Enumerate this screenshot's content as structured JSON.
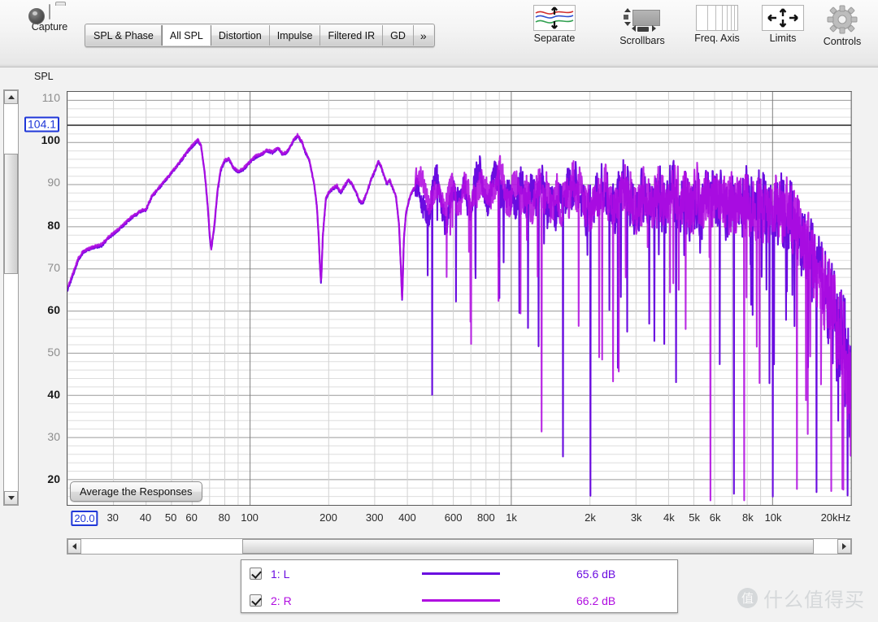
{
  "toolbar": {
    "capture": {
      "label": "Capture",
      "icon": "camera-icon"
    },
    "tabs": [
      {
        "label": "SPL & Phase",
        "active": false
      },
      {
        "label": "All SPL",
        "active": true
      },
      {
        "label": "Distortion",
        "active": false
      },
      {
        "label": "Impulse",
        "active": false
      },
      {
        "label": "Filtered IR",
        "active": false
      },
      {
        "label": "GD",
        "active": false
      },
      {
        "label": "»",
        "active": false
      }
    ],
    "buttons": [
      {
        "label": "Separate",
        "icon": "separate-traces-icon"
      },
      {
        "label": "Scrollbars",
        "icon": "scrollbars-icon"
      },
      {
        "label": "Freq. Axis",
        "icon": "frequency-axis-icon"
      },
      {
        "label": "Limits",
        "icon": "limits-arrows-icon"
      },
      {
        "label": "Controls",
        "icon": "gear-icon"
      }
    ]
  },
  "graph": {
    "y_axis_title": "SPL",
    "y_cursor_value": "104.1",
    "x_cursor_value": "20.0",
    "average_button_label": "Average the Responses"
  },
  "legend": {
    "rows": [
      {
        "checked": true,
        "name": "1: L",
        "color": "#6a0ce0",
        "value": "65.6 dB"
      },
      {
        "checked": true,
        "name": "2: R",
        "color": "#b00ce0",
        "value": "66.2 dB"
      }
    ]
  },
  "watermark": {
    "logo": "值",
    "text": "什么值得买"
  },
  "chart_data": {
    "type": "line",
    "title": "All SPL",
    "xlabel": "",
    "ylabel": "SPL",
    "xscale": "log",
    "xlim": [
      20,
      20000
    ],
    "ylim": [
      14,
      112
    ],
    "grid": true,
    "legend_position": "bottom",
    "y_ticks_major": [
      100,
      80,
      60,
      40,
      20
    ],
    "y_ticks_minor": [
      110,
      90,
      70,
      50,
      30
    ],
    "y_tick_labels": [
      "110",
      "100",
      "90",
      "80",
      "70",
      "60",
      "50",
      "40",
      "30",
      "20"
    ],
    "x_tick_labels": [
      "20.0",
      "30",
      "40",
      "50",
      "60",
      "80",
      "100",
      "200",
      "300",
      "400",
      "600",
      "800",
      "1k",
      "2k",
      "3k",
      "4k",
      "5k",
      "6k",
      "8k",
      "10k",
      "20kHz"
    ],
    "x_tick_values": [
      20,
      30,
      40,
      50,
      60,
      80,
      100,
      200,
      300,
      400,
      600,
      800,
      1000,
      2000,
      3000,
      4000,
      5000,
      6000,
      8000,
      10000,
      20000
    ],
    "cursor_line_y": 104.1,
    "series": [
      {
        "name": "1: L",
        "color": "#6a0ce0",
        "value_label": "65.6 dB",
        "points": [
          [
            20,
            65.0
          ],
          [
            21,
            68.5
          ],
          [
            22,
            72.0
          ],
          [
            23,
            74.0
          ],
          [
            25,
            75.0
          ],
          [
            27,
            75.5
          ],
          [
            29,
            77.5
          ],
          [
            31,
            79.0
          ],
          [
            33,
            80.5
          ],
          [
            35,
            82.0
          ],
          [
            37,
            83.0
          ],
          [
            38,
            83.5
          ],
          [
            40,
            84.0
          ],
          [
            42,
            87.0
          ],
          [
            44,
            88.5
          ],
          [
            46,
            90.0
          ],
          [
            49,
            92.0
          ],
          [
            52,
            94.0
          ],
          [
            55,
            96.0
          ],
          [
            58,
            98.0
          ],
          [
            61,
            99.5
          ],
          [
            63,
            100.5
          ],
          [
            65,
            99.0
          ],
          [
            67,
            93.0
          ],
          [
            69,
            84.0
          ],
          [
            70,
            78.0
          ],
          [
            71,
            74.5
          ],
          [
            73,
            80.0
          ],
          [
            75,
            88.0
          ],
          [
            77,
            93.0
          ],
          [
            80,
            95.5
          ],
          [
            83,
            96.0
          ],
          [
            86,
            94.0
          ],
          [
            90,
            93.0
          ],
          [
            94,
            93.5
          ],
          [
            99,
            95.0
          ],
          [
            105,
            96.5
          ],
          [
            110,
            97.0
          ],
          [
            116,
            98.0
          ],
          [
            122,
            97.5
          ],
          [
            128,
            98.5
          ],
          [
            134,
            97.0
          ],
          [
            140,
            98.0
          ],
          [
            147,
            100.5
          ],
          [
            152,
            101.5
          ],
          [
            158,
            100.0
          ],
          [
            163,
            97.5
          ],
          [
            168,
            96.0
          ],
          [
            172,
            93.0
          ],
          [
            176,
            90.0
          ],
          [
            180,
            85.0
          ],
          [
            183,
            78.0
          ],
          [
            185,
            71.0
          ],
          [
            187,
            66.5
          ],
          [
            190,
            78.0
          ],
          [
            195,
            86.5
          ],
          [
            200,
            88.0
          ],
          [
            208,
            89.0
          ],
          [
            215,
            89.5
          ],
          [
            222,
            88.0
          ],
          [
            230,
            89.5
          ],
          [
            238,
            91.0
          ],
          [
            246,
            90.0
          ],
          [
            255,
            88.0
          ],
          [
            262,
            86.0
          ],
          [
            270,
            85.5
          ],
          [
            280,
            88.0
          ],
          [
            290,
            91.0
          ],
          [
            300,
            93.0
          ],
          [
            310,
            95.5
          ],
          [
            318,
            94.0
          ],
          [
            326,
            92.0
          ],
          [
            334,
            90.0
          ],
          [
            342,
            91.0
          ],
          [
            352,
            89.0
          ],
          [
            362,
            87.0
          ],
          [
            372,
            80.0
          ],
          [
            378,
            70.0
          ],
          [
            382,
            62.0
          ],
          [
            388,
            77.0
          ],
          [
            395,
            83.0
          ],
          [
            405,
            86.0
          ],
          [
            415,
            88.0
          ],
          [
            425,
            89.0
          ],
          [
            440,
            90.0
          ],
          [
            455,
            88.0
          ],
          [
            470,
            85.0
          ],
          [
            485,
            83.0
          ],
          [
            500,
            88.0
          ],
          [
            520,
            92.0
          ],
          [
            540,
            87.0
          ],
          [
            560,
            84.0
          ],
          [
            580,
            88.0
          ],
          [
            600,
            91.0
          ],
          [
            620,
            87.0
          ],
          [
            640,
            89.0
          ],
          [
            660,
            92.0
          ],
          [
            680,
            88.0
          ],
          [
            700,
            85.0
          ],
          [
            730,
            89.0
          ],
          [
            760,
            92.0
          ],
          [
            790,
            87.0
          ],
          [
            820,
            84.0
          ],
          [
            860,
            89.0
          ],
          [
            900,
            91.0
          ],
          [
            950,
            86.0
          ],
          [
            1000,
            88.0
          ],
          [
            1100,
            90.0
          ],
          [
            1200,
            86.0
          ],
          [
            1300,
            88.0
          ],
          [
            1400,
            84.0
          ],
          [
            1500,
            87.0
          ],
          [
            1700,
            89.0
          ],
          [
            1900,
            85.0
          ],
          [
            2100,
            87.0
          ],
          [
            2400,
            86.0
          ],
          [
            2700,
            88.0
          ],
          [
            3000,
            85.0
          ],
          [
            3400,
            87.0
          ],
          [
            3800,
            86.0
          ],
          [
            4300,
            88.0
          ],
          [
            4800,
            85.0
          ],
          [
            5400,
            86.0
          ],
          [
            6000,
            87.0
          ],
          [
            6800,
            85.0
          ],
          [
            7600,
            86.0
          ],
          [
            8500,
            84.0
          ],
          [
            9500,
            85.0
          ],
          [
            10500,
            84.0
          ],
          [
            12000,
            83.0
          ],
          [
            13500,
            82.0
          ],
          [
            15000,
            80.0
          ],
          [
            17000,
            76.0
          ],
          [
            19000,
            68.0
          ],
          [
            20000,
            62.0
          ]
        ]
      },
      {
        "name": "2: R",
        "color": "#b00ce0",
        "value_label": "66.2 dB",
        "points": [
          [
            20,
            65.5
          ],
          [
            21,
            69.0
          ],
          [
            22,
            72.5
          ],
          [
            23,
            74.2
          ],
          [
            25,
            75.2
          ],
          [
            27,
            75.8
          ],
          [
            29,
            77.8
          ],
          [
            31,
            79.2
          ],
          [
            33,
            80.8
          ],
          [
            35,
            82.2
          ],
          [
            37,
            83.2
          ],
          [
            38,
            83.8
          ],
          [
            40,
            84.2
          ],
          [
            42,
            87.2
          ],
          [
            44,
            88.8
          ],
          [
            46,
            90.2
          ],
          [
            49,
            92.2
          ],
          [
            52,
            94.2
          ],
          [
            55,
            96.2
          ],
          [
            58,
            98.2
          ],
          [
            61,
            99.8
          ],
          [
            63,
            100.8
          ],
          [
            65,
            99.2
          ],
          [
            67,
            93.2
          ],
          [
            69,
            84.5
          ],
          [
            70,
            78.5
          ],
          [
            71,
            74.8
          ],
          [
            73,
            80.5
          ],
          [
            75,
            88.5
          ],
          [
            77,
            93.5
          ],
          [
            80,
            95.8
          ],
          [
            83,
            96.2
          ],
          [
            86,
            94.2
          ],
          [
            90,
            93.2
          ],
          [
            94,
            93.8
          ],
          [
            99,
            95.2
          ],
          [
            105,
            96.8
          ],
          [
            110,
            97.2
          ],
          [
            116,
            98.2
          ],
          [
            122,
            97.8
          ],
          [
            128,
            98.8
          ],
          [
            134,
            97.2
          ],
          [
            140,
            98.2
          ],
          [
            147,
            100.8
          ],
          [
            152,
            101.8
          ],
          [
            158,
            100.2
          ],
          [
            163,
            97.8
          ],
          [
            168,
            96.2
          ],
          [
            172,
            93.2
          ],
          [
            176,
            90.2
          ],
          [
            180,
            85.2
          ],
          [
            183,
            78.2
          ],
          [
            185,
            71.2
          ],
          [
            187,
            66.8
          ],
          [
            190,
            78.2
          ],
          [
            195,
            86.8
          ],
          [
            200,
            88.2
          ],
          [
            208,
            89.2
          ],
          [
            215,
            89.8
          ],
          [
            222,
            88.2
          ],
          [
            230,
            89.8
          ],
          [
            238,
            91.2
          ],
          [
            246,
            90.2
          ],
          [
            255,
            88.2
          ],
          [
            262,
            86.2
          ],
          [
            270,
            85.8
          ],
          [
            280,
            88.2
          ],
          [
            290,
            91.2
          ],
          [
            300,
            93.2
          ],
          [
            310,
            95.8
          ],
          [
            318,
            94.2
          ],
          [
            326,
            92.2
          ],
          [
            334,
            90.2
          ],
          [
            342,
            91.2
          ],
          [
            352,
            89.2
          ],
          [
            362,
            87.2
          ],
          [
            372,
            80.2
          ],
          [
            378,
            70.2
          ],
          [
            382,
            62.2
          ],
          [
            388,
            77.2
          ],
          [
            395,
            83.2
          ],
          [
            405,
            86.2
          ],
          [
            415,
            88.2
          ],
          [
            425,
            89.2
          ],
          [
            440,
            90.2
          ],
          [
            455,
            88.2
          ],
          [
            470,
            85.2
          ],
          [
            485,
            83.2
          ],
          [
            500,
            88.2
          ],
          [
            520,
            92.2
          ],
          [
            540,
            87.2
          ],
          [
            560,
            84.2
          ],
          [
            580,
            88.2
          ],
          [
            600,
            91.2
          ],
          [
            620,
            87.2
          ],
          [
            640,
            89.2
          ],
          [
            660,
            92.2
          ],
          [
            680,
            88.2
          ],
          [
            700,
            85.2
          ],
          [
            730,
            89.2
          ],
          [
            760,
            92.2
          ],
          [
            790,
            87.2
          ],
          [
            820,
            84.2
          ],
          [
            860,
            89.2
          ],
          [
            900,
            91.2
          ],
          [
            950,
            86.2
          ],
          [
            1000,
            88.2
          ],
          [
            1100,
            90.2
          ],
          [
            1200,
            86.2
          ],
          [
            1300,
            88.2
          ],
          [
            1400,
            84.2
          ],
          [
            1500,
            87.2
          ],
          [
            1700,
            89.2
          ],
          [
            1900,
            85.2
          ],
          [
            2100,
            87.2
          ],
          [
            2400,
            86.2
          ],
          [
            2700,
            88.2
          ],
          [
            3000,
            85.2
          ],
          [
            3400,
            87.2
          ],
          [
            3800,
            86.2
          ],
          [
            4300,
            88.2
          ],
          [
            4800,
            85.2
          ],
          [
            5400,
            86.2
          ],
          [
            6000,
            87.2
          ],
          [
            6800,
            85.2
          ],
          [
            7600,
            86.2
          ],
          [
            8500,
            84.2
          ],
          [
            9500,
            85.2
          ],
          [
            10500,
            84.2
          ],
          [
            12000,
            83.2
          ],
          [
            13500,
            82.2
          ],
          [
            15000,
            80.2
          ],
          [
            17000,
            76.2
          ],
          [
            19000,
            68.2
          ],
          [
            20000,
            62.2
          ]
        ]
      }
    ],
    "notes": "Dense high-frequency noise/comb structure above ~500 Hz; two nearly coincident traces (L blue-violet, R magenta) with deep narrow nulls."
  }
}
